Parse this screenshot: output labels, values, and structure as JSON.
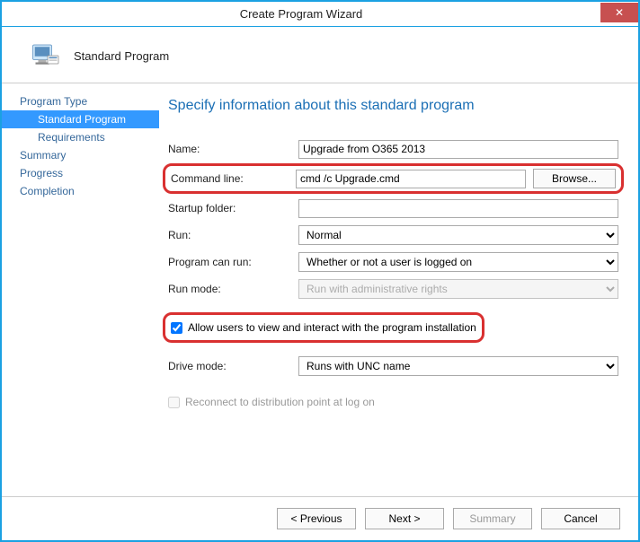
{
  "window": {
    "title": "Create Program Wizard",
    "close": "✕"
  },
  "header": {
    "title": "Standard Program"
  },
  "sidebar": {
    "items": [
      {
        "label": "Program Type"
      },
      {
        "label": "Standard Program"
      },
      {
        "label": "Requirements"
      },
      {
        "label": "Summary"
      },
      {
        "label": "Progress"
      },
      {
        "label": "Completion"
      }
    ]
  },
  "page": {
    "title": "Specify information about this standard program"
  },
  "form": {
    "name_label": "Name:",
    "name_value": "Upgrade from O365 2013",
    "cmd_label": "Command line:",
    "cmd_value": "cmd /c Upgrade.cmd",
    "browse_label": "Browse...",
    "startup_label": "Startup folder:",
    "startup_value": "",
    "run_label": "Run:",
    "run_value": "Normal",
    "canrun_label": "Program can run:",
    "canrun_value": "Whether or not a user is logged on",
    "runmode_label": "Run mode:",
    "runmode_value": "Run with administrative rights",
    "allow_label": "Allow users to view and interact with the program installation",
    "drive_label": "Drive mode:",
    "drive_value": "Runs with UNC name",
    "reconnect_label": "Reconnect to distribution point at log on"
  },
  "footer": {
    "prev": "< Previous",
    "next": "Next >",
    "summary": "Summary",
    "cancel": "Cancel"
  }
}
